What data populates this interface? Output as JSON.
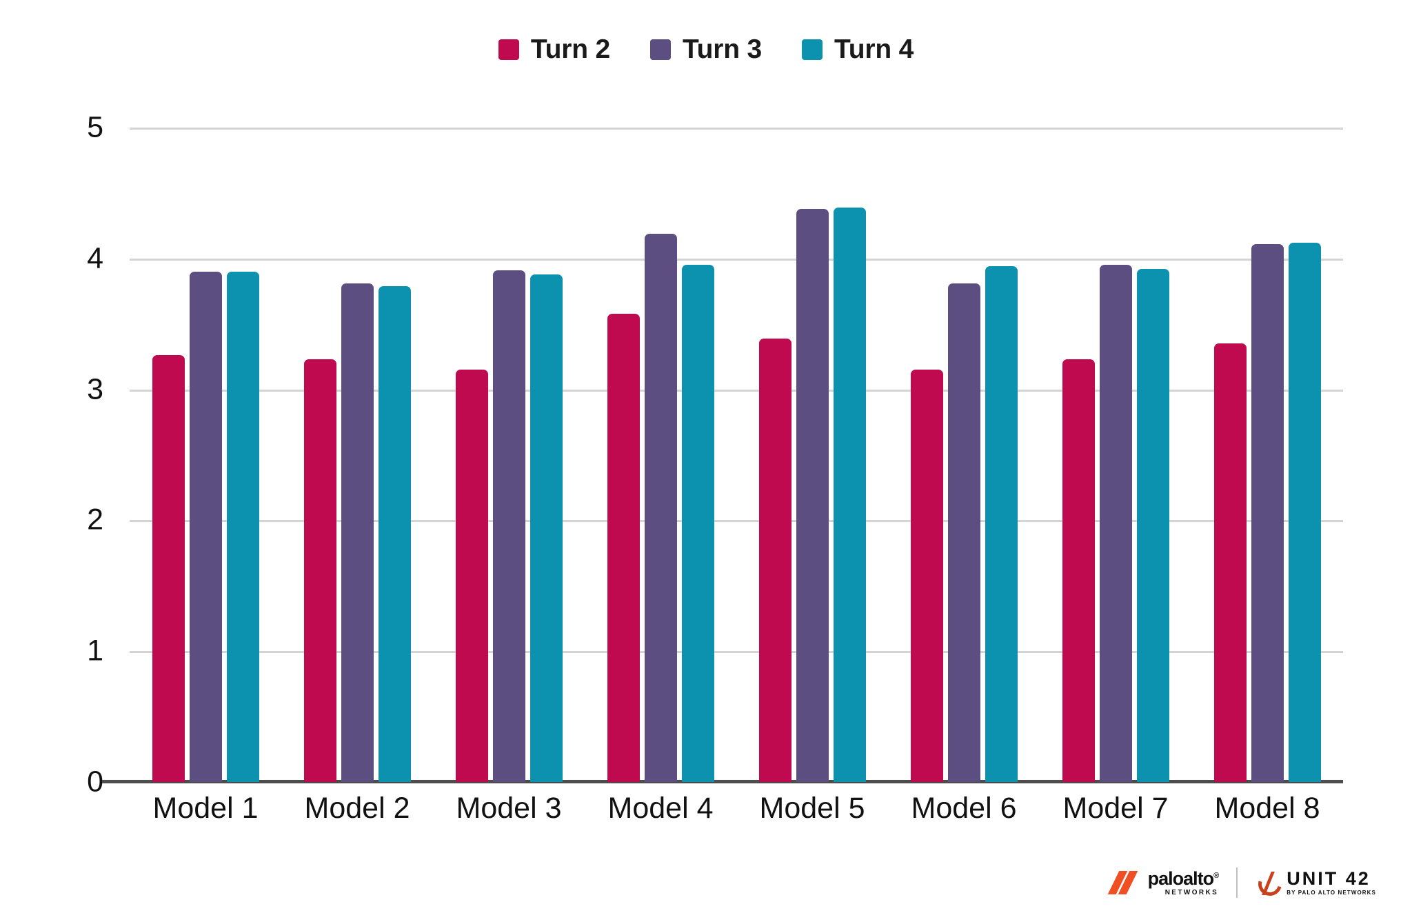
{
  "chart_data": {
    "type": "bar",
    "title": "",
    "subtitle": "",
    "xlabel": "",
    "ylabel": "",
    "ylim": [
      0,
      5
    ],
    "yticks": [
      0,
      1,
      2,
      3,
      4,
      5
    ],
    "ytick_labels": [
      "0",
      "1",
      "2",
      "3",
      "4",
      "5"
    ],
    "grid": true,
    "legend_position": "top-center",
    "categories": [
      "Model 1",
      "Model 2",
      "Model 3",
      "Model 4",
      "Model 5",
      "Model 6",
      "Model 7",
      "Model 8"
    ],
    "series": [
      {
        "name": "Turn 2",
        "color": "#C00A50",
        "values": [
          3.26,
          3.23,
          3.15,
          3.58,
          3.39,
          3.15,
          3.23,
          3.35
        ]
      },
      {
        "name": "Turn 3",
        "color": "#5D4E82",
        "values": [
          3.9,
          3.81,
          3.91,
          4.19,
          4.38,
          3.81,
          3.95,
          4.11
        ]
      },
      {
        "name": "Turn 4",
        "color": "#0C92AF",
        "values": [
          3.9,
          3.79,
          3.88,
          3.95,
          4.39,
          3.94,
          3.92,
          4.12
        ]
      }
    ]
  },
  "colors": {
    "turn2": "#C00A50",
    "turn3": "#5D4E82",
    "turn4": "#0C92AF",
    "gridline": "#d4d4d4",
    "axis": "#4d4d4d",
    "text": "#111111",
    "background": "#ffffff",
    "brand_orange": "#F04E23"
  },
  "footer": {
    "paloalto": {
      "name": "paloalto",
      "registered": "®",
      "sub": "NETWORKS"
    },
    "unit42": {
      "name": "UNIT 42",
      "sub": "BY PALO ALTO NETWORKS"
    }
  }
}
